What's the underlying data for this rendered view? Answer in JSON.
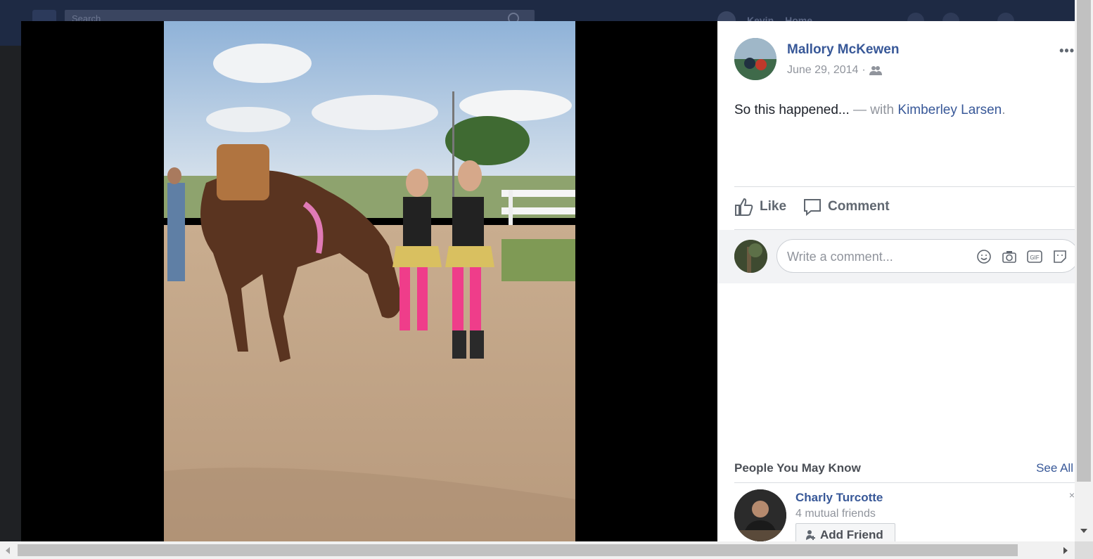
{
  "background": {
    "search_placeholder": "Search",
    "user_name": "Kevin",
    "home_label": "Home"
  },
  "post": {
    "author": "Mallory McKewen",
    "date": "June 29, 2014",
    "meta_separator": "·",
    "audience_icon": "friends-icon",
    "text": "So this happened...",
    "with_text": "— with",
    "tagged_name": "Kimberley Larsen",
    "tagged_suffix": ".",
    "more_label": "•••"
  },
  "actions": {
    "like_label": "Like",
    "comment_label": "Comment"
  },
  "comment_box": {
    "placeholder": "Write a comment...",
    "icons": [
      "emoji-icon",
      "camera-icon",
      "gif-icon",
      "sticker-icon"
    ],
    "gif_label": "GIF"
  },
  "pymk": {
    "title": "People You May Know",
    "see_all": "See All",
    "person": {
      "name": "Charly Turcotte",
      "mutual": "4 mutual friends",
      "add_friend_label": "Add Friend",
      "close_label": "×"
    }
  },
  "colors": {
    "link": "#385898",
    "muted": "#90949c",
    "text": "#1d2129",
    "theater_bg": "#000000"
  }
}
